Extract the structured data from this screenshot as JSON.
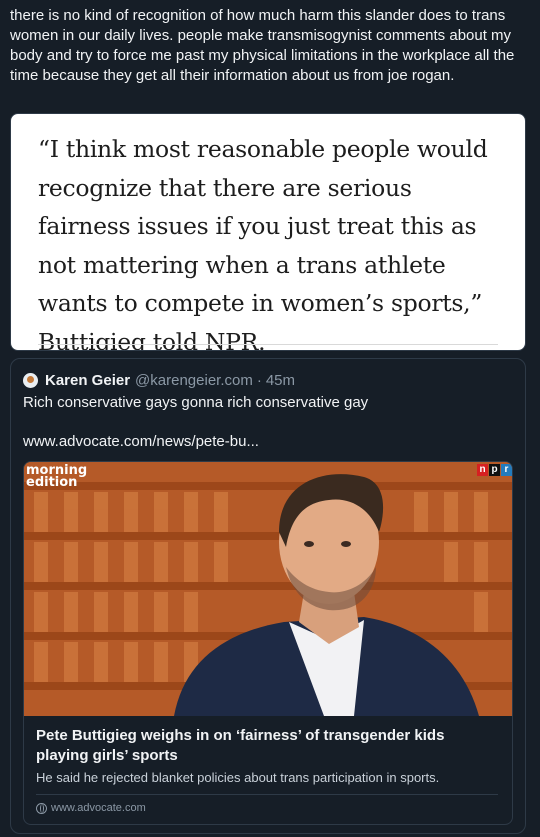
{
  "post": {
    "text": "there is no kind of recognition of how much harm this slander does to trans women in our daily lives. people make transmisogynist comments about my body and try to force me past my physical limitations in the workplace all the time because they get all their information about us from joe rogan."
  },
  "quote_image": {
    "text": "“I think most reasonable people would recognize that there are serious fairness issues if you just treat this as not mattering when a trans athlete wants to compete in women’s sports,” Buttigieg told NPR."
  },
  "embed": {
    "author": "Karen Geier",
    "handle": "@karengeier.com",
    "separator": "·",
    "time": "45m",
    "body": "Rich conservative gays gonna rich conservative gay",
    "link_text": "www.advocate.com/news/pete-bu...",
    "card": {
      "show_logo_line1": "morning",
      "show_logo_line2": "edition",
      "network_logo": [
        "n",
        "p",
        "r"
      ],
      "network_colors": [
        "#d62021",
        "#111111",
        "#237bbd"
      ],
      "title": "Pete Buttigieg weighs in on ‘fairness’ of transgender kids playing girls’ sports",
      "description": "He said he rejected blanket policies about trans participation in sports.",
      "domain": "www.advocate.com"
    }
  },
  "colors": {
    "background": "#161e27",
    "border": "#2e3a47",
    "muted": "#8b98a5"
  }
}
